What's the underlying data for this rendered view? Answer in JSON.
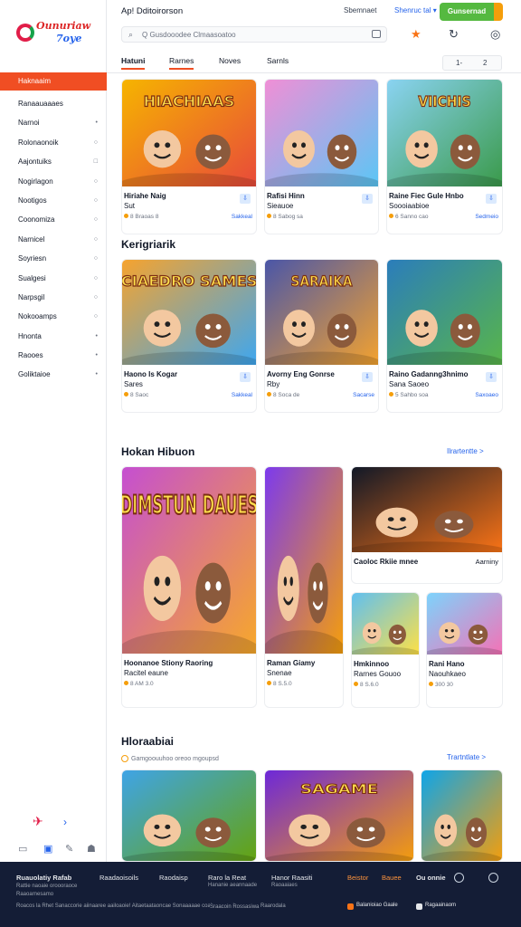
{
  "logo": {
    "line1": "Ounuriaw",
    "line2": "7oye"
  },
  "header": {
    "title": "Ap! Dditoirorson",
    "title_right": "Sbemnaet",
    "select_label": "Shenruc tal",
    "cta_label": "Gunsernad",
    "search_placeholder": "Q Gusdooodee Clmaasoatoo"
  },
  "tabs": [
    "Hatuni",
    "Rarnes",
    "Noves",
    "Sarnls"
  ],
  "active_tab": 0,
  "pager": {
    "prev": "1-",
    "next": "2"
  },
  "sidebar": {
    "items": [
      {
        "label": "Haknaaim",
        "active": true,
        "icon": ""
      },
      {
        "label": "Ranaauaaaes",
        "icon": ""
      },
      {
        "label": "Narnoi",
        "icon": "•"
      },
      {
        "label": "Rolonaonoik",
        "icon": "○"
      },
      {
        "label": "Aajontuiks",
        "icon": "□"
      },
      {
        "label": "Nogirlagon",
        "icon": "○"
      },
      {
        "label": "Nootigos",
        "icon": "○"
      },
      {
        "label": "Coonomiza",
        "icon": "○"
      },
      {
        "label": "Narnicel",
        "icon": "○"
      },
      {
        "label": "Soyriesn",
        "icon": "○"
      },
      {
        "label": "Sualgesi",
        "icon": "○"
      },
      {
        "label": "Narpsgil",
        "icon": "○"
      },
      {
        "label": "Nokooamps",
        "icon": "○"
      },
      {
        "label": "Hnonta",
        "icon": "•"
      },
      {
        "label": "Raooes",
        "icon": "•"
      },
      {
        "label": "Goliktaioe",
        "icon": "•"
      }
    ]
  },
  "section1": {
    "cards": [
      {
        "art": "HIACHIAAS",
        "title": "Hiriahe Naig",
        "sub": "Sut",
        "meta": "8 Braoas 8",
        "meta2": "Sakkeal",
        "colors": [
          "#f6b400",
          "#e84a3a"
        ]
      },
      {
        "art": "",
        "title": "Rafisi Hinn",
        "sub": "Sieauoe",
        "meta": "8 Sabog sa",
        "meta2": "",
        "colors": [
          "#f08fd6",
          "#5bc6f5"
        ]
      },
      {
        "art": "VIICHIS",
        "title": "Raine Fiec Gule Hnbo",
        "sub": "Soooiaabioe",
        "meta": "6 Sanno cao",
        "meta2": "Sedmeio",
        "colors": [
          "#8ad3f2",
          "#3a9a4a"
        ]
      }
    ]
  },
  "section2": {
    "title": "Kerigriarik",
    "cards": [
      {
        "art": "CIAEDRO SAMES",
        "title": "Haono Is Kogar",
        "sub": "Sares",
        "meta": "8 Saoc",
        "meta2": "Sakkeal",
        "colors": [
          "#f6a32e",
          "#3ea6ef"
        ]
      },
      {
        "art": "SARAIKA",
        "title": "Avorny Eng Gonrse",
        "sub": "Rby",
        "meta": "8 Soca de",
        "meta2": "Sacarse",
        "colors": [
          "#4a56a8",
          "#f3a22f"
        ]
      },
      {
        "art": "",
        "title": "Raino Gadanng3hnimo",
        "sub": "Sana Saoeo",
        "meta": "5 Sahbo soa",
        "meta2": "Saxoaeo",
        "colors": [
          "#2b7dbb",
          "#58b54a"
        ]
      }
    ]
  },
  "section3": {
    "title": "Hokan Hibuon",
    "link": "Ilrartentte >",
    "cards": [
      {
        "art": "DIMSTUN DAUES",
        "title": "Hoonanoe Stiony Raoring",
        "sub": "Racitel eaune",
        "meta": "8 AM  3.0",
        "meta2": "",
        "colors": [
          "#c54fd1",
          "#f7a82a"
        ]
      },
      {
        "art": "",
        "title": "Raman Giamy",
        "sub": "Snenae",
        "meta": "8 S.5.0",
        "meta2": "",
        "colors": [
          "#7c3aed",
          "#f59e0b"
        ]
      },
      {
        "art": "",
        "title": "Caoloc Rkiie mnee",
        "sub": "",
        "meta": "",
        "meta2": "",
        "badge": "Aarniny",
        "colors": [
          "#111827",
          "#f97316"
        ]
      },
      {
        "art": "",
        "title": "Hmkinnoo",
        "sub": "Rarnes Gouoo",
        "meta": "8 S.6.0",
        "meta2": "",
        "colors": [
          "#60c0f0",
          "#fde047"
        ]
      },
      {
        "art": "",
        "title": "Rani Hano",
        "sub": "Naouhkaeo",
        "meta": "300  30",
        "meta2": "",
        "colors": [
          "#7dd3fc",
          "#f472b6"
        ]
      }
    ]
  },
  "section4": {
    "title": "Hloraabiai",
    "sub": "Gamgoouuhoo oreoo mgoupsd",
    "link": "Trartntlate >",
    "cards": [
      {
        "art": "",
        "colors": [
          "#3fa4e6",
          "#65a30d"
        ]
      },
      {
        "art": "SAGAME",
        "colors": [
          "#6d28d9",
          "#f59e0b"
        ]
      },
      {
        "art": "",
        "colors": [
          "#0ea5e9",
          "#f59e0b"
        ]
      }
    ]
  },
  "footer": {
    "col1": [
      "Ruauolatiy Rafab",
      "Rattie naoaie oroooraoce",
      "Raaoarnesamo"
    ],
    "col2": "Raadaoisoils",
    "col3": "Raodaisp",
    "col4": [
      "Raro la Reat",
      "Hananie aeannaade"
    ],
    "col5": [
      "Hanor Raasiti",
      "Raoaaiaes"
    ],
    "col6": "Beistor",
    "col7": "Bauee",
    "col8": "Ou onnie",
    "bottom": "Roacos la Rhet Sanaccorie aiinaaree aailoaoie! Aitaetaataoncae Sonaaaaae coaiaaaoaeoiea",
    "bottom2": "Sraacoin Rossasiwa ▸",
    "bottom3": "Raarodala",
    "link1": "Balanioiao Gaale",
    "link2": "Ragaainaom"
  }
}
